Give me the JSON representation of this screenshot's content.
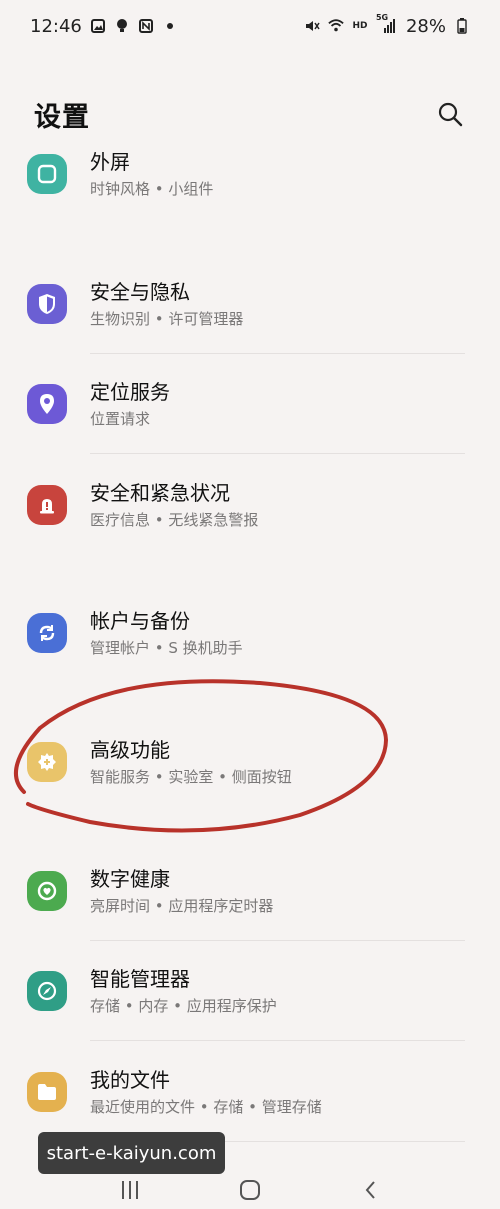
{
  "status": {
    "time": "12:46",
    "left_icons": [
      "image-icon",
      "bulb-icon",
      "nfc-icon",
      "dot-icon"
    ],
    "right_icons": [
      "mute-icon",
      "wifi-icon",
      "hd-icon",
      "signal-icon"
    ],
    "hd_label": "HD",
    "network_label": "5G",
    "battery": "28%"
  },
  "header": {
    "title": "设置",
    "search_icon": "search-icon"
  },
  "items": [
    {
      "title": "外屏",
      "subtitle": "时钟风格 • 小组件",
      "icon": "cover-screen-icon",
      "color": "#3fb3a2"
    },
    {
      "title": "安全与隐私",
      "subtitle": "生物识别 • 许可管理器",
      "icon": "shield-icon",
      "color": "#6b5fd3"
    },
    {
      "title": "定位服务",
      "subtitle": "位置请求",
      "icon": "location-pin-icon",
      "color": "#6d59d6"
    },
    {
      "title": "安全和紧急状况",
      "subtitle": "医疗信息 • 无线紧急警报",
      "icon": "emergency-icon",
      "color": "#c8443d"
    },
    {
      "title": "帐户与备份",
      "subtitle": "管理帐户 • S 换机助手",
      "icon": "sync-icon",
      "color": "#4a6fd6"
    },
    {
      "title": "高级功能",
      "subtitle": "智能服务 • 实验室 • 侧面按钮",
      "icon": "advanced-gear-icon",
      "color": "#e9c46a"
    },
    {
      "title": "数字健康",
      "subtitle": "亮屏时间 • 应用程序定时器",
      "icon": "wellbeing-icon",
      "color": "#4caa4f"
    },
    {
      "title": "智能管理器",
      "subtitle": "存储 • 内存 • 应用程序保护",
      "icon": "device-care-icon",
      "color": "#2f9e86"
    },
    {
      "title": "我的文件",
      "subtitle": "最近使用的文件 • 存储 • 管理存储",
      "icon": "folder-icon",
      "color": "#e4b14f"
    }
  ],
  "watermark": "start-e-kaiyun.com",
  "nav": {
    "recents_icon": "recents-icon",
    "home_icon": "home-icon",
    "back_icon": "back-icon"
  },
  "annotation_color": "#b8322a"
}
